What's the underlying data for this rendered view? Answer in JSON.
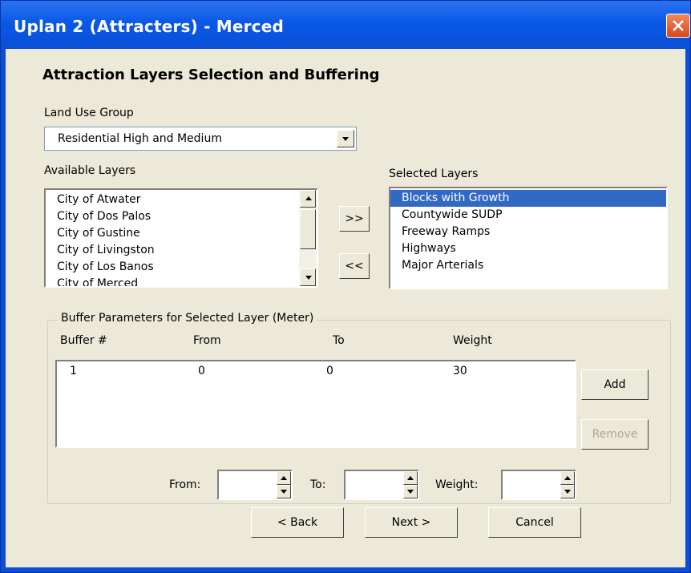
{
  "window": {
    "title": "Uplan 2 (Attracters) - Merced"
  },
  "heading": "Attraction Layers Selection and Buffering",
  "land_use": {
    "label": "Land Use Group",
    "selected": "Residential High and Medium"
  },
  "available": {
    "label": "Available Layers",
    "items": [
      "City of Atwater",
      "City of Dos Palos",
      "City of Gustine",
      "City of Livingston",
      "City of Los Banos",
      "City of Merced"
    ]
  },
  "selected": {
    "label": "Selected Layers",
    "items": [
      "Blocks with Growth",
      "Countywide SUDP",
      "Freeway Ramps",
      "Highways",
      "Major Arterials"
    ],
    "selected_index": 0
  },
  "move_buttons": {
    "add": ">>",
    "remove": "<<"
  },
  "buffer": {
    "title": "Buffer Parameters for Selected Layer (Meter)",
    "columns": [
      "Buffer #",
      "From",
      "To",
      "Weight"
    ],
    "rows": [
      [
        "1",
        "0",
        "0",
        "30"
      ]
    ],
    "add_label": "Add",
    "remove_label": "Remove",
    "from_label": "From:",
    "to_label": "To:",
    "weight_label": "Weight:"
  },
  "footer": {
    "back": "< Back",
    "next": "Next >",
    "cancel": "Cancel"
  },
  "colors": {
    "titlebar": "#0a4fd6",
    "face": "#ece9d8",
    "selection": "#316ac5",
    "close": "#d8481e"
  }
}
